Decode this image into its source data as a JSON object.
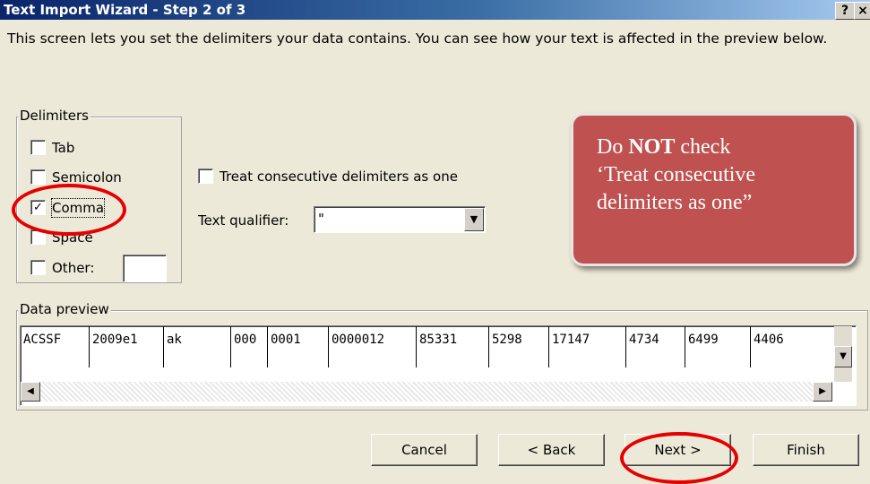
{
  "window": {
    "title": "Text Import Wizard - Step 2 of 3",
    "help_button": "?",
    "close_button": "×"
  },
  "description": "This screen lets you set the delimiters your data contains.  You can see how your text is affected in the preview below.",
  "delimiters": {
    "group_label": "Delimiters",
    "options": [
      {
        "label": "Tab",
        "checked": false
      },
      {
        "label": "Semicolon",
        "checked": false
      },
      {
        "label": "Comma",
        "checked": true
      },
      {
        "label": "Space",
        "checked": false
      },
      {
        "label": "Other:",
        "checked": false
      }
    ],
    "other_value": ""
  },
  "consecutive": {
    "label": "Treat consecutive delimiters as one",
    "checked": false
  },
  "qualifier": {
    "label": "Text qualifier:",
    "value": "\""
  },
  "preview": {
    "group_label": "Data preview",
    "columns": [
      "ACSSF",
      "2009e1",
      "ak",
      "000",
      "0001",
      "0000012",
      "85331",
      "5298",
      "17147",
      "4734",
      "6499",
      "4406"
    ]
  },
  "buttons": {
    "cancel": "Cancel",
    "back": "< Back",
    "next": "Next >",
    "finish": "Finish"
  },
  "callout": {
    "line1_prefix": "Do ",
    "line1_bold": "NOT",
    "line1_suffix": " check",
    "line2": "‘Treat consecutive",
    "line3": "delimiters as one”"
  },
  "colors": {
    "callout": "#bf5250",
    "highlight_circle": "#e60000",
    "titlebar": "#0a246a"
  }
}
